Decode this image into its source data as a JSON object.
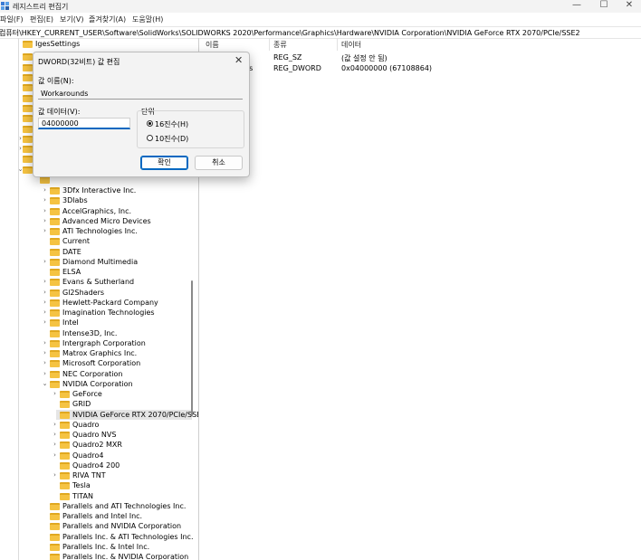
{
  "window": {
    "title": "레지스트리 편집기",
    "minimize": "—",
    "maximize": "☐",
    "close": "✕"
  },
  "menu": [
    "파일(F)",
    "편집(E)",
    "보기(V)",
    "즐겨찾기(A)",
    "도움말(H)"
  ],
  "address": "컴퓨터\\HKEY_CURRENT_USER\\Software\\SolidWorks\\SOLIDWORKS 2020\\Performance\\Graphics\\Hardware\\NVIDIA Corporation\\NVIDIA GeForce RTX 2070/PCIe/SSE2",
  "tree": {
    "top_item": "IgesSettings",
    "vendors": [
      "3Dfx Interactive Inc.",
      "3Dlabs",
      "AccelGraphics, Inc.",
      "Advanced Micro Devices",
      "ATI Technologies Inc.",
      "Current",
      "DATE",
      "Diamond Multimedia",
      "ELSA",
      "Evans & Sutherland",
      "Gl2Shaders",
      "Hewlett-Packard Company",
      "Imagination Technologies",
      "Intel",
      "Intense3D, Inc.",
      "Intergraph Corporation",
      "Matrox Graphics Inc.",
      "Microsoft Corporation",
      "NEC Corporation",
      "NVIDIA Corporation"
    ],
    "nvidia_children": [
      "GeForce",
      "GRID",
      "NVIDIA GeForce RTX 2070/PCIe/SSE2",
      "Quadro",
      "Quadro NVS",
      "Quadro2 MXR",
      "Quadro4",
      "Quadro4 200",
      "RIVA TNT",
      "Tesla",
      "TITAN"
    ],
    "after": [
      "Parallels and ATI Technologies Inc.",
      "Parallels and Intel Inc.",
      "Parallels and NVIDIA Corporation",
      "Parallels Inc. & ATI Technologies Inc.",
      "Parallels Inc. & Intel Inc.",
      "Parallels Inc. & NVIDIA Corporation"
    ],
    "selected": "NVIDIA GeForce RTX 2070/PCIe/SSE2"
  },
  "listview": {
    "headers": {
      "name": "이름",
      "type": "종류",
      "data": "데이터"
    },
    "rows": [
      {
        "name": "",
        "type": "REG_SZ",
        "data": "(값 설정 안 됨)"
      },
      {
        "name": "ds",
        "type": "REG_DWORD",
        "data": "0x04000000 (67108864)"
      }
    ]
  },
  "dialog": {
    "title": "DWORD(32비트) 값 편집",
    "close": "✕",
    "name_label": "값 이름(N):",
    "name_value": "Workarounds",
    "data_label": "값 데이터(V):",
    "data_value": "04000000",
    "base_label": "단위",
    "hex_label": "16진수(H)",
    "dec_label": "10진수(D)",
    "selected_base": "hex",
    "ok": "확인",
    "cancel": "취소"
  },
  "colors": {
    "accent": "#0067c0",
    "folder": "#f5c342",
    "selection": "#e5e5e5"
  }
}
